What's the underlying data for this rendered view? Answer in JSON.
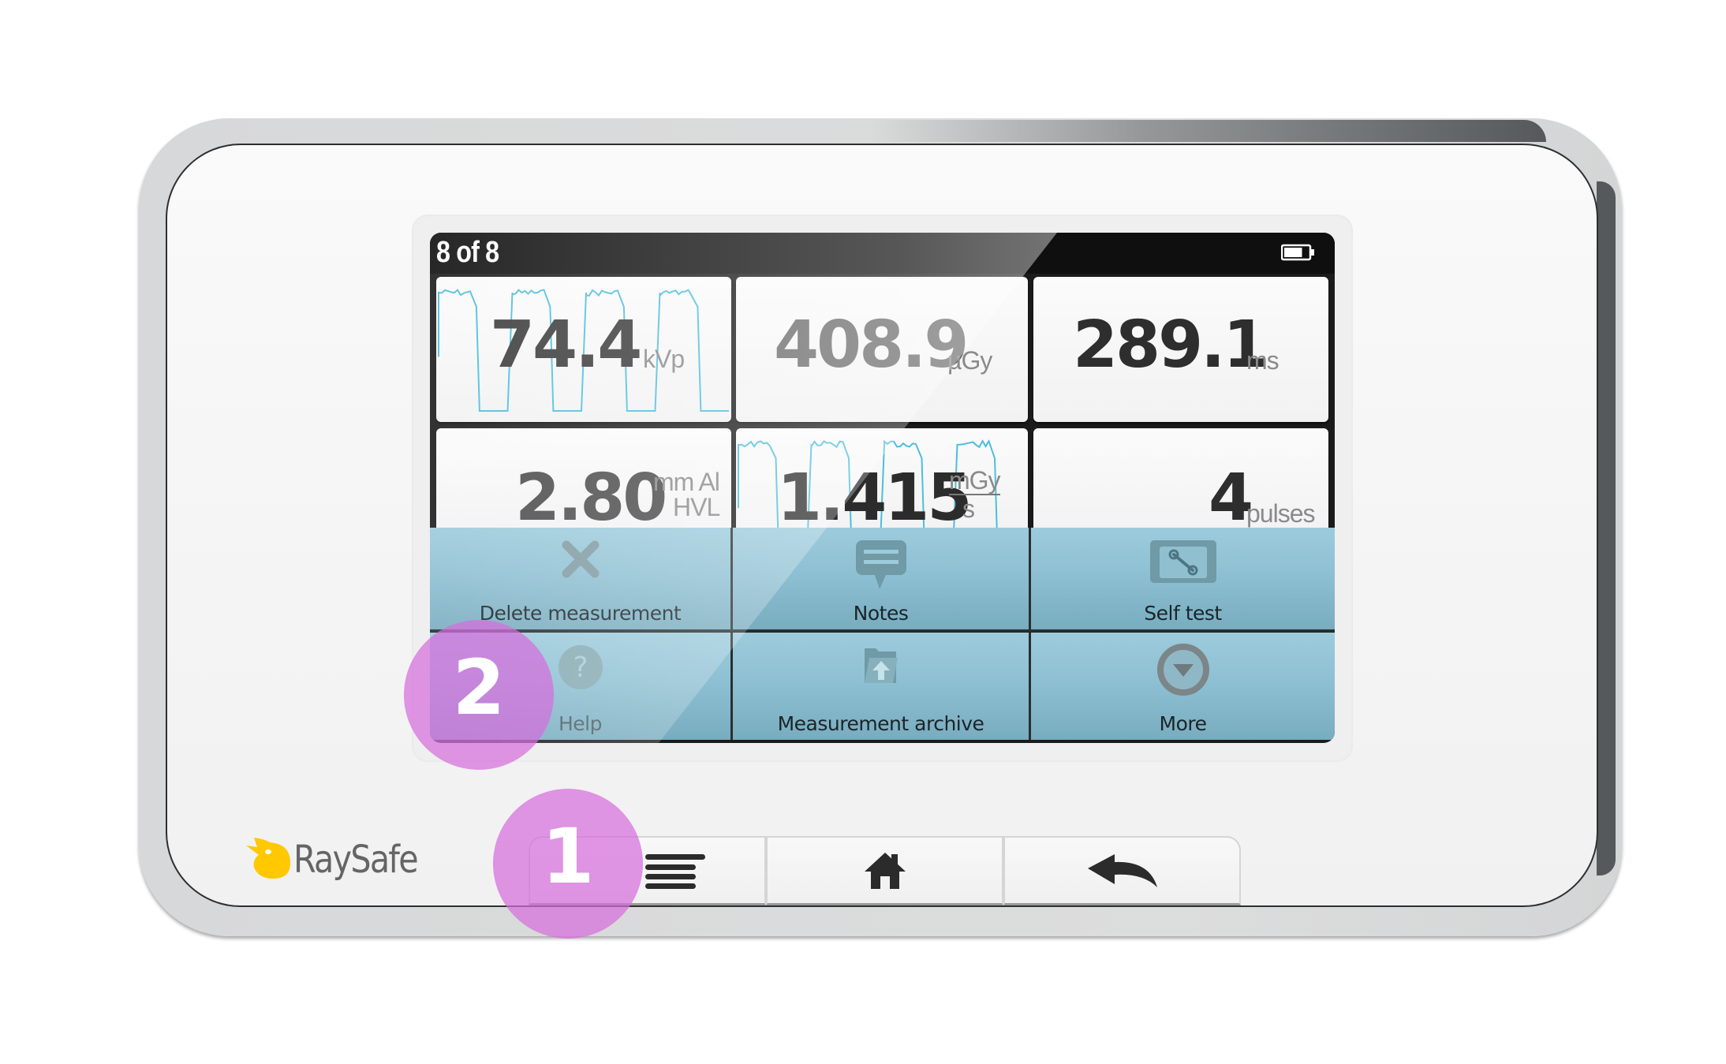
{
  "device": {
    "brand": "RaySafe",
    "brand_color": "#FFC800"
  },
  "screen": {
    "status": {
      "measurement_index": "8 of 8",
      "battery_level": 0.75,
      "battery_icon": "battery-icon"
    },
    "tiles": [
      {
        "name": "kvp",
        "value": "74.4",
        "unit": "kVp",
        "has_waveform": true
      },
      {
        "name": "dose",
        "value": "408.9",
        "unit": "µGy",
        "has_waveform": false
      },
      {
        "name": "exposure-time",
        "value": "289.1",
        "unit": "ms",
        "has_waveform": false
      },
      {
        "name": "hvl",
        "value": "2.80",
        "unit_top": "mm Al",
        "unit_bottom": "HVL",
        "has_waveform": false
      },
      {
        "name": "dose-rate",
        "value": "1.415",
        "unit_top": "mGy",
        "unit_bottom": "s",
        "has_waveform": true
      },
      {
        "name": "pulses",
        "value": "4",
        "unit": "pulses",
        "has_waveform": false
      }
    ],
    "menu": [
      {
        "label": "Delete measurement",
        "icon": "close-icon"
      },
      {
        "label": "Notes",
        "icon": "speech-bubble-icon"
      },
      {
        "label": "Self test",
        "icon": "wrench-screen-icon"
      },
      {
        "label": "Help",
        "icon": "question-icon"
      },
      {
        "label": "Measurement archive",
        "icon": "folder-upload-icon"
      },
      {
        "label": "More",
        "icon": "circle-down-icon"
      }
    ],
    "waveform_color": "#4DBEDC"
  },
  "hardware_buttons": [
    {
      "name": "menu",
      "icon": "menu-lines-icon"
    },
    {
      "name": "home",
      "icon": "home-icon"
    },
    {
      "name": "back",
      "icon": "back-arrow-icon"
    }
  ],
  "callouts": [
    {
      "number": "1",
      "target": "menu hardware button"
    },
    {
      "number": "2",
      "target": "Help menu item"
    }
  ],
  "callout_color": "#D66EDC"
}
